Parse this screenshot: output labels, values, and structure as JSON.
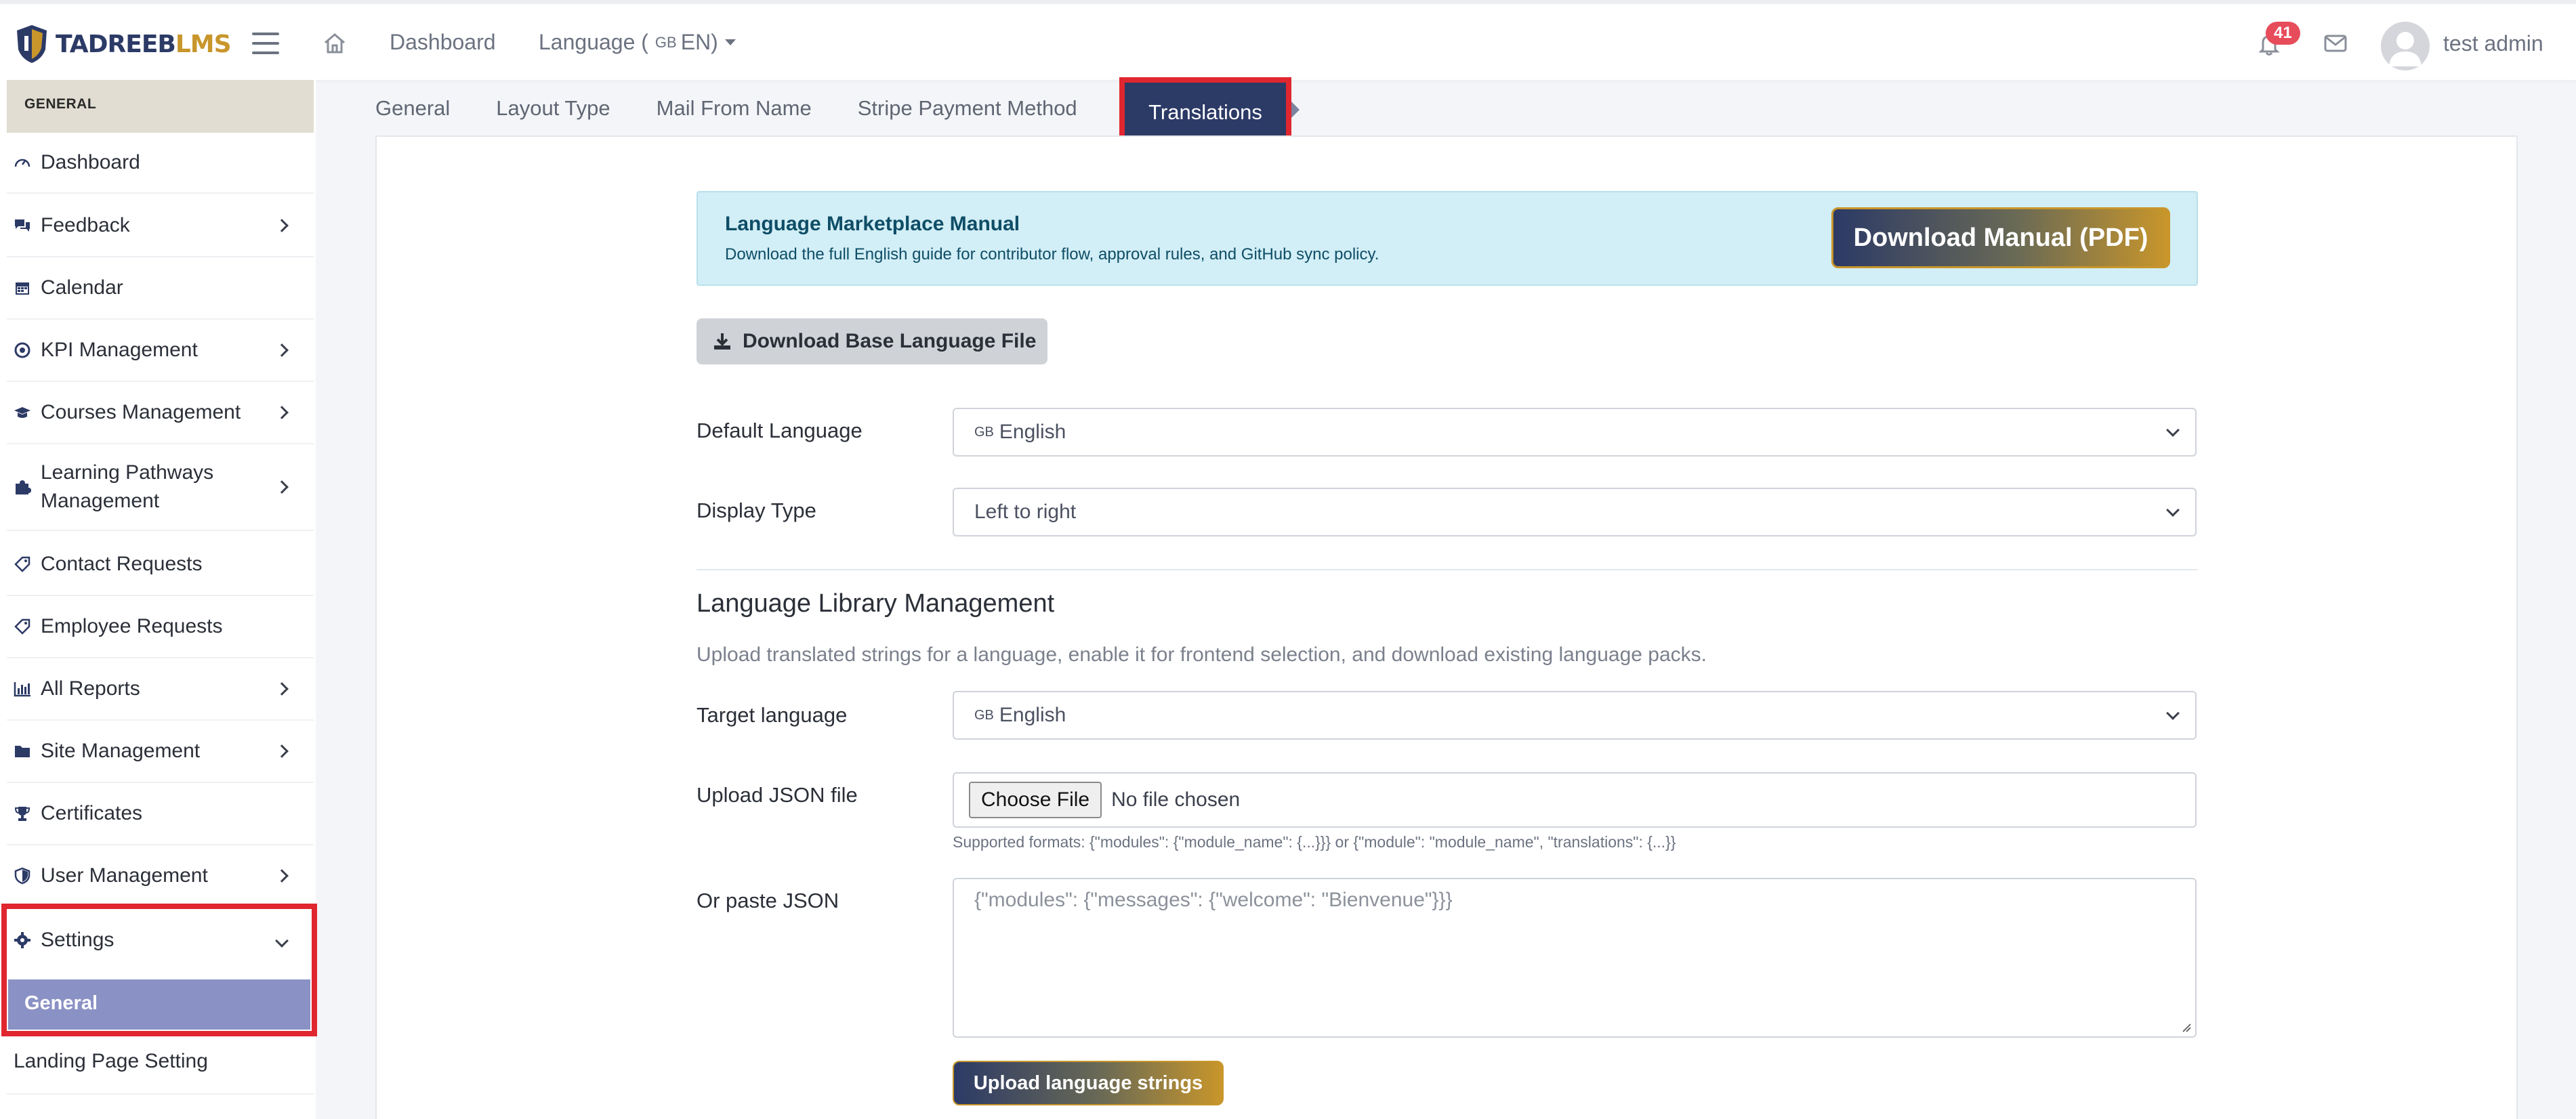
{
  "header": {
    "logo": {
      "part1": "TADREEB",
      "part2": "LMS"
    },
    "nav_dashboard": "Dashboard",
    "nav_language": {
      "label": "Language (",
      "flag": "GB",
      "code": "EN)"
    },
    "notification_count": "41",
    "user_name": "test admin"
  },
  "sidebar": {
    "section_header": "GENERAL",
    "items": [
      {
        "label": "Dashboard",
        "icon": "gauge-icon",
        "has_chevron": false
      },
      {
        "label": "Feedback",
        "icon": "comments-icon",
        "has_chevron": true
      },
      {
        "label": "Calendar",
        "icon": "calendar-icon",
        "has_chevron": false
      },
      {
        "label": "KPI Management",
        "icon": "target-icon",
        "has_chevron": true
      },
      {
        "label": "Courses Management",
        "icon": "graduation-cap-icon",
        "has_chevron": true
      },
      {
        "label": "Learning Pathways",
        "label2": "Management",
        "icon": "puzzle-icon",
        "has_chevron": true
      },
      {
        "label": "Contact Requests",
        "icon": "tag-icon",
        "has_chevron": false
      },
      {
        "label": "Employee Requests",
        "icon": "tag-icon",
        "has_chevron": false
      },
      {
        "label": "All Reports",
        "icon": "bar-chart-icon",
        "has_chevron": true
      },
      {
        "label": "Site Management",
        "icon": "folder-icon",
        "has_chevron": true
      },
      {
        "label": "Certificates",
        "icon": "trophy-icon",
        "has_chevron": false
      },
      {
        "label": "User Management",
        "icon": "shield-icon",
        "has_chevron": true
      },
      {
        "label": "Settings",
        "icon": "gear-icon",
        "has_chevron": true
      }
    ],
    "settings_sub_active": "General",
    "settings_sub_next": "Landing Page Setting"
  },
  "tabs": {
    "items": [
      "General",
      "Layout Type",
      "Mail From Name",
      "Stripe Payment Method"
    ],
    "active": "Translations"
  },
  "manual_alert": {
    "title": "Language Marketplace Manual",
    "text": "Download the full English guide for contributor flow, approval rules, and GitHub sync policy.",
    "button": "Download Manual (PDF)"
  },
  "download_base_button": "Download Base Language File",
  "form": {
    "default_language": {
      "label": "Default Language",
      "flag": "GB",
      "value": "English"
    },
    "display_type": {
      "label": "Display Type",
      "value": "Left to right"
    }
  },
  "library": {
    "title": "Language Library Management",
    "description": "Upload translated strings for a language, enable it for frontend selection, and download existing language packs.",
    "target_language": {
      "label": "Target language",
      "flag": "GB",
      "value": "English"
    },
    "upload_json": {
      "label": "Upload JSON file",
      "button": "Choose File",
      "status": "No file chosen"
    },
    "supported_formats": "Supported formats: {\"modules\": {\"module_name\": {...}}} or {\"module\": \"module_name\", \"translations\": {...}}",
    "paste_json": {
      "label": "Or paste JSON",
      "placeholder": "{\"modules\": {\"messages\": {\"welcome\": \"Bienvenue\"}}}"
    },
    "upload_button": "Upload language strings"
  },
  "colors": {
    "brand_navy": "#2c3a66",
    "brand_gold": "#c8962b",
    "highlight_red": "#e0262f",
    "sidebar_active": "#8a91c4",
    "alert_bg": "#d2eef6",
    "badge_red": "#e74c5b"
  }
}
